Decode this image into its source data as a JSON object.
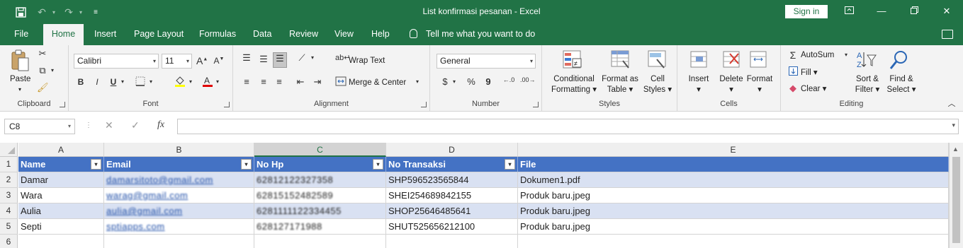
{
  "titlebar": {
    "title": "List konfirmasi pesanan  -  Excel",
    "signin": "Sign in",
    "save_icon": "save-icon",
    "undo_icon": "undo-icon",
    "redo_icon": "redo-icon"
  },
  "tabs": [
    "File",
    "Home",
    "Insert",
    "Page Layout",
    "Formulas",
    "Data",
    "Review",
    "View",
    "Help"
  ],
  "tellme": "Tell me what you want to do",
  "ribbon": {
    "clipboard": {
      "label": "Clipboard",
      "paste": "Paste"
    },
    "font": {
      "label": "Font",
      "name": "Calibri",
      "size": "11",
      "bold": "B",
      "italic": "I",
      "underline": "U",
      "grow": "A",
      "shrink": "A"
    },
    "alignment": {
      "label": "Alignment",
      "wrap": "Wrap Text",
      "merge": "Merge & Center"
    },
    "number": {
      "label": "Number",
      "format": "General",
      "currency": "$",
      "percent": "%",
      "comma": "9"
    },
    "styles": {
      "label": "Styles",
      "conditional": "Conditional Formatting",
      "cond_l1": "Conditional",
      "cond_l2": "Formatting",
      "table_l1": "Format as",
      "table_l2": "Table",
      "cell_l1": "Cell",
      "cell_l2": "Styles"
    },
    "cells": {
      "label": "Cells",
      "insert": "Insert",
      "delete": "Delete",
      "format": "Format"
    },
    "editing": {
      "label": "Editing",
      "autosum": "AutoSum",
      "fill": "Fill",
      "clear": "Clear",
      "sort_l1": "Sort &",
      "sort_l2": "Filter",
      "find_l1": "Find &",
      "find_l2": "Select"
    }
  },
  "formula_bar": {
    "namebox": "C8",
    "cancel": "✕",
    "enter": "✓",
    "fx": "fx",
    "value": ""
  },
  "columns": [
    "A",
    "B",
    "C",
    "D",
    "E"
  ],
  "rows": [
    "1",
    "2",
    "3",
    "4",
    "5",
    "6"
  ],
  "headers": [
    "Name",
    "Email",
    "No Hp",
    "No Transaksi",
    "File"
  ],
  "data": [
    [
      "Damar",
      "damarsitoto@gmail.com",
      "62812122327358",
      "SHP596523565844",
      "Dokumen1.pdf"
    ],
    [
      "Wara",
      "warag@gmail.com",
      "62815152482589",
      "SHEI254689842155",
      "Produk baru.jpeg"
    ],
    [
      "Aulia",
      "aulia@gmail.com",
      "6281111122334455",
      "SHOP25646485641",
      "Produk baru.jpeg"
    ],
    [
      "Septi",
      "sptiapps.com",
      "628127171988",
      "SHUT525656212100",
      "Produk baru.jpeg"
    ]
  ],
  "colors": {
    "excel_green": "#217346",
    "table_header": "#4472c4",
    "band": "#d9e1f2"
  }
}
